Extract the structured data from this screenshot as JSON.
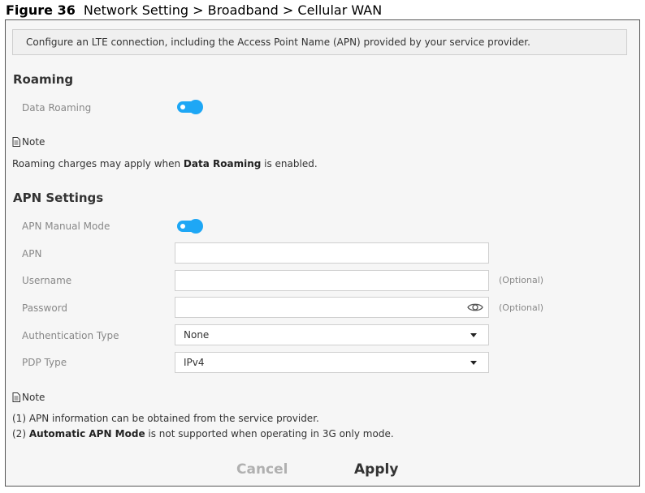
{
  "figure": {
    "number": "Figure 36",
    "title": "Network Setting > Broadband > Cellular WAN"
  },
  "banner": {
    "text": "Configure an LTE connection, including the Access Point Name (APN) provided by your service provider."
  },
  "roaming": {
    "title": "Roaming",
    "data_roaming_label": "Data Roaming",
    "data_roaming_enabled": true
  },
  "note1": {
    "label": "Note",
    "text_pre": "Roaming charges may apply when ",
    "text_bold": "Data Roaming",
    "text_post": " is enabled."
  },
  "apn": {
    "title": "APN Settings",
    "manual_mode_label": "APN Manual Mode",
    "manual_mode_enabled": true,
    "apn_label": "APN",
    "apn_value": "",
    "username_label": "Username",
    "username_value": "",
    "username_hint": "(Optional)",
    "password_label": "Password",
    "password_value": "",
    "password_hint": "(Optional)",
    "auth_label": "Authentication Type",
    "auth_value": "None",
    "pdp_label": "PDP Type",
    "pdp_value": "IPv4"
  },
  "note2": {
    "label": "Note",
    "line1": "(1) APN information can be obtained from the service provider.",
    "line2_pre": "(2) ",
    "line2_bold": "Automatic APN Mode",
    "line2_post": " is not supported when operating in 3G only mode."
  },
  "buttons": {
    "cancel": "Cancel",
    "apply": "Apply"
  },
  "colors": {
    "toggle_on": "#1ea7f5",
    "apply_accent": "#f5b800"
  }
}
